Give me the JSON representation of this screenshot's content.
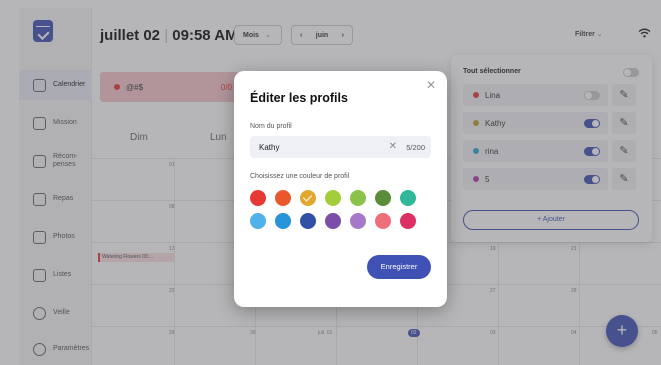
{
  "sidebar": {
    "items": [
      {
        "label": "Calendrier",
        "icon": "calendar-icon"
      },
      {
        "label": "Mission",
        "icon": "mission-icon"
      },
      {
        "label": "Récom-\npenses",
        "icon": "star-icon"
      },
      {
        "label": "Repas",
        "icon": "utensils-icon"
      },
      {
        "label": "Photos",
        "icon": "photo-icon"
      },
      {
        "label": "Listes",
        "icon": "list-icon"
      },
      {
        "label": "Veille",
        "icon": "sun-icon"
      },
      {
        "label": "Paramètres",
        "icon": "gear-icon"
      }
    ]
  },
  "topbar": {
    "date": "juillet 02",
    "time": "09:58 AM",
    "view_select": "Mois",
    "month_nav": "juin",
    "prev": "‹",
    "next": "›",
    "filter": "Filtrer"
  },
  "calendar": {
    "filter_profile": "@#$",
    "filter_count": "0/0",
    "days": [
      "Dim",
      "Lun"
    ],
    "event": "Watering Flowers 03:...",
    "row_dates": [
      [
        "01",
        "",
        "",
        "",
        "",
        "",
        ""
      ],
      [
        "08",
        "",
        "",
        "",
        "",
        "",
        ""
      ],
      [
        "13",
        "",
        "",
        "",
        "",
        "19",
        "21"
      ],
      [
        "22",
        "",
        "",
        "",
        "",
        "27",
        "28"
      ],
      [
        "29",
        "30",
        "juil. 01",
        "02",
        "03",
        "04",
        "05"
      ]
    ],
    "today": "02"
  },
  "profiles_panel": {
    "select_all": "Tout sélectionner",
    "profiles": [
      {
        "name": "Lina",
        "color": "#e53935",
        "enabled": false
      },
      {
        "name": "Kathy",
        "color": "#c0a02a",
        "enabled": true
      },
      {
        "name": "rina",
        "color": "#29a8e0",
        "enabled": true
      },
      {
        "name": "5",
        "color": "#b23fb5",
        "enabled": true
      }
    ],
    "add_label": "+ Ajouter"
  },
  "modal": {
    "title": "Éditer les profils",
    "name_label": "Nom du profil",
    "name_value": "Kathy",
    "counter": "5/200",
    "color_label": "Choisissez une couleur de profil",
    "save_label": "Enregistrer",
    "colors": [
      "#e53935",
      "#e8582c",
      "#e3a72f",
      "#a4cd3a",
      "#8bc34a",
      "#5b8c3a",
      "#2fb89a",
      "#4fb3e8",
      "#2694d6",
      "#3150a8",
      "#7b4fa8",
      "#a678c8",
      "#ee6e7a",
      "#dc2f63"
    ],
    "selected_color": "#e3a72f"
  }
}
